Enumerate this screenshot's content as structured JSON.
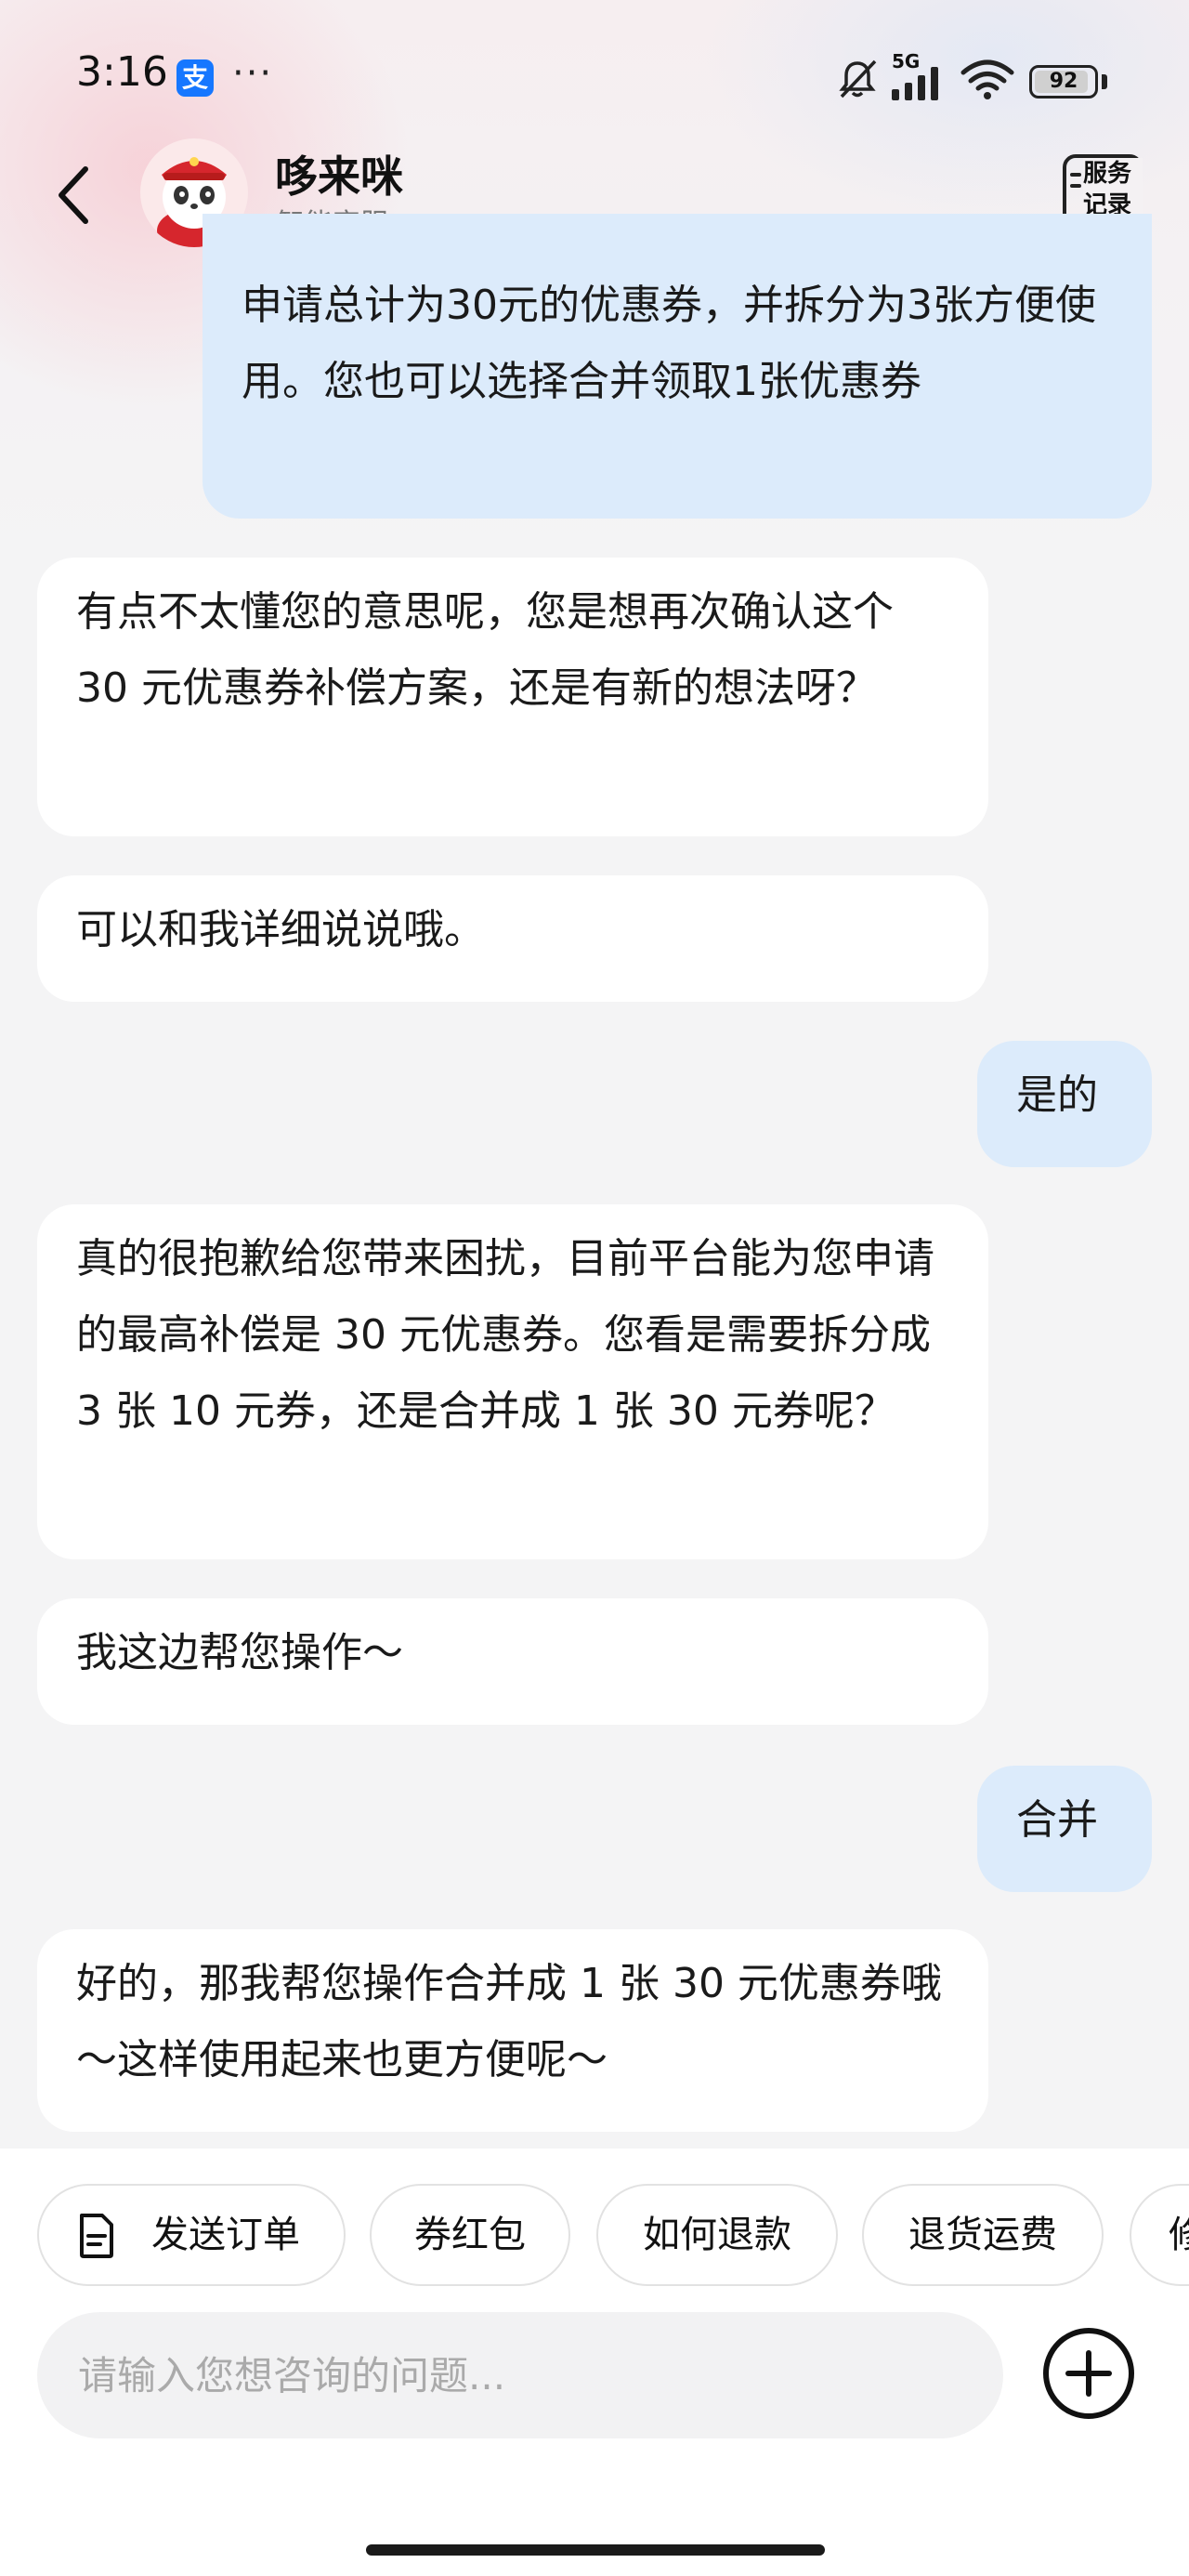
{
  "status_bar": {
    "time": "3:16",
    "app_icon_glyph": "支",
    "more_dots": "···",
    "network_label": "5G",
    "battery_level": "92",
    "battery_fraction": 0.92
  },
  "header": {
    "title": "哆来咪",
    "subtitle": "智能客服",
    "record_label_line1": "服务",
    "record_label_line2": "记录"
  },
  "messages": [
    {
      "role": "user",
      "text": "申请总计为30元的优惠券，并拆分为3张方便使用。您也可以选择合并领取1张优惠券"
    },
    {
      "role": "bot",
      "text": "有点不太懂您的意思呢，您是想再次确认这个 30 元优惠券补偿方案，还是有新的想法呀？"
    },
    {
      "role": "bot",
      "text": "可以和我详细说说哦。"
    },
    {
      "role": "user",
      "text": "是的"
    },
    {
      "role": "bot",
      "text": "真的很抱歉给您带来困扰，目前平台能为您申请的最高补偿是 30 元优惠券。您看是需要拆分成 3 张 10 元券，还是合并成 1 张 30 元券呢？"
    },
    {
      "role": "bot",
      "text": "我这边帮您操作～"
    },
    {
      "role": "user",
      "text": "合并"
    },
    {
      "role": "bot",
      "text": "好的，那我帮您操作合并成 1 张 30 元优惠券哦～这样使用起来也更方便呢～"
    }
  ],
  "quick_actions": [
    {
      "label": "发送订单",
      "icon": "document-icon"
    },
    {
      "label": "券红包"
    },
    {
      "label": "如何退款"
    },
    {
      "label": "退货运费"
    },
    {
      "label": "修"
    }
  ],
  "input": {
    "placeholder": "请输入您想咨询的问题..."
  },
  "colors": {
    "user_bubble": "#dcebfb",
    "bot_bubble": "#ffffff",
    "background": "#f4f4f5"
  }
}
